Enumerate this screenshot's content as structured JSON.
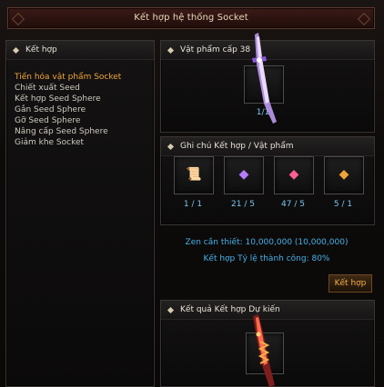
{
  "window": {
    "title": "Kết hợp hệ thống Socket"
  },
  "sidebar": {
    "title": "Kết hợp",
    "items": [
      {
        "label": "Tiến hóa vật phẩm Socket",
        "active": true
      },
      {
        "label": "Chiết xuất Seed"
      },
      {
        "label": "Kết hợp Seed Sphere"
      },
      {
        "label": "Gắn Seed Sphere"
      },
      {
        "label": "Gỡ Seed Sphere"
      },
      {
        "label": "Nâng cấp Seed Sphere"
      },
      {
        "label": "Giảm khe Socket"
      }
    ]
  },
  "item_panel": {
    "title": "Vật phẩm cấp 38",
    "count": "1/1"
  },
  "materials": {
    "title": "Ghi chú Kết hợp / Vật phẩm",
    "slots": [
      {
        "icon": "scroll-icon",
        "count": "1 / 1"
      },
      {
        "icon": "purple-gem-icon",
        "count": "21 / 5"
      },
      {
        "icon": "pink-gem-icon",
        "count": "47 / 5"
      },
      {
        "icon": "orange-gem-icon",
        "count": "5 / 1"
      }
    ]
  },
  "info": {
    "zen_required": "Zen cần thiết: 10,000,000 (10,000,000)",
    "success_rate": "Kết hợp Tỷ lệ thành công: 80%"
  },
  "buttons": {
    "combine": "Kết hợp"
  },
  "result_panel": {
    "title": "Kết quả Kết hợp Dự kiến"
  },
  "colors": {
    "active_menu": "#f0a53d",
    "info_text": "#47b1ea",
    "count_text": "#79c6f0"
  }
}
